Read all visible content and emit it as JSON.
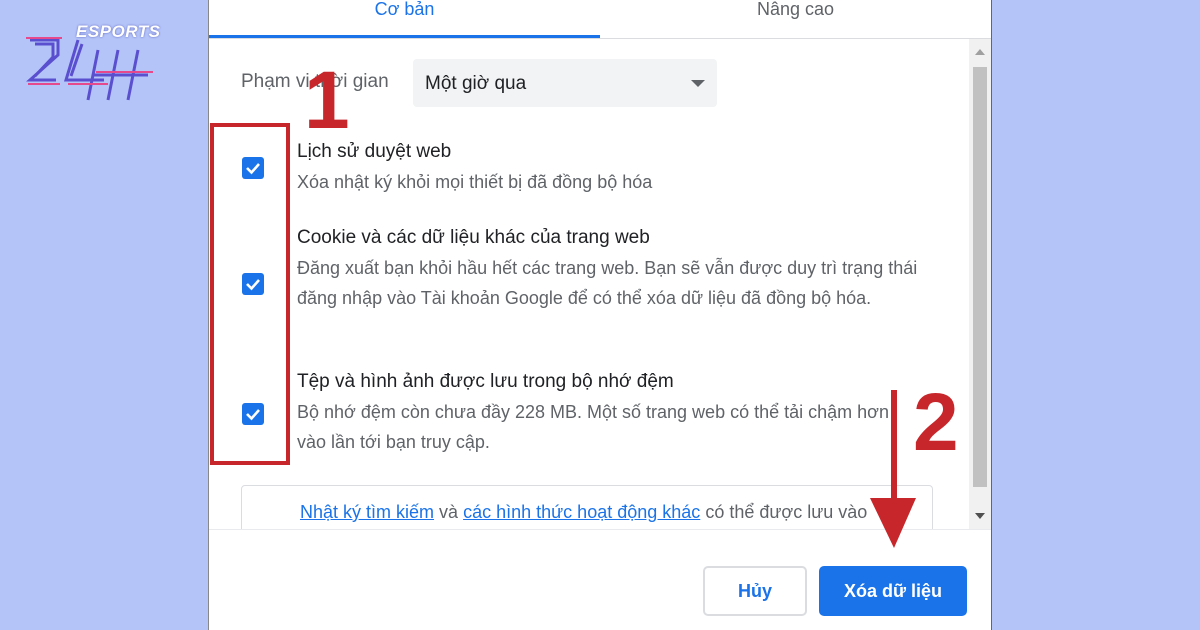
{
  "logo": {
    "text": "ESPORTS",
    "mark": "24H"
  },
  "tabs": [
    {
      "label": "Cơ bản"
    },
    {
      "label": "Nâng cao"
    }
  ],
  "time_range": {
    "label": "Phạm vi thời gian",
    "value": "Một giờ qua"
  },
  "options": [
    {
      "title": "Lịch sử duyệt web",
      "desc": "Xóa nhật ký khỏi mọi thiết bị đã đồng bộ hóa",
      "checked": true
    },
    {
      "title": "Cookie và các dữ liệu khác của trang web",
      "desc": "Đăng xuất bạn khỏi hầu hết các trang web. Bạn sẽ vẫn được duy trì trạng thái đăng nhập vào Tài khoản Google để có thể xóa dữ liệu đã đồng bộ hóa.",
      "checked": true
    },
    {
      "title": "Tệp và hình ảnh được lưu trong bộ nhớ đệm",
      "desc": "Bộ nhớ đệm còn chưa đầy 228 MB. Một số trang web có thể tải chậm hơn vào lần tới bạn truy cập.",
      "checked": true
    }
  ],
  "info": {
    "link1": "Nhật ký tìm kiếm",
    "and": "và",
    "link2": "các hình thức hoạt động khác",
    "rest": "có thể được lưu vào"
  },
  "buttons": {
    "cancel": "Hủy",
    "clear": "Xóa dữ liệu"
  },
  "annotations": {
    "step1": "1",
    "step2": "2",
    "color": "#c7262b"
  },
  "colors": {
    "accent": "#1a73e8",
    "background": "#b4c4f8"
  }
}
